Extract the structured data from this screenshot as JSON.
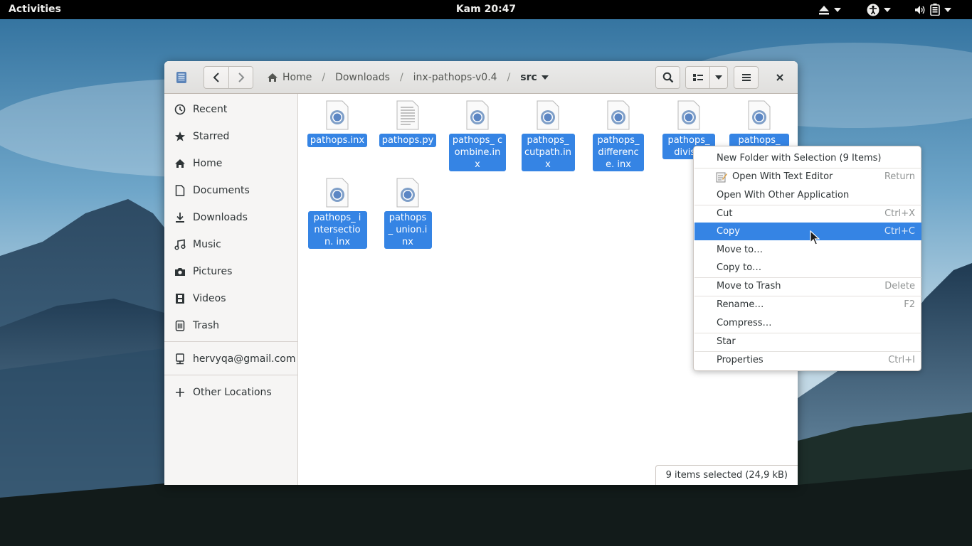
{
  "topbar": {
    "activities": "Activities",
    "clock": "Kam 20:47"
  },
  "window": {
    "breadcrumbs": [
      "Home",
      "Downloads",
      "inx-pathops-v0.4",
      "src"
    ]
  },
  "sidebar": {
    "items": [
      {
        "label": "Recent",
        "icon": "clock-icon"
      },
      {
        "label": "Starred",
        "icon": "star-icon"
      },
      {
        "label": "Home",
        "icon": "home-icon"
      },
      {
        "label": "Documents",
        "icon": "document-icon"
      },
      {
        "label": "Downloads",
        "icon": "download-icon"
      },
      {
        "label": "Music",
        "icon": "music-icon"
      },
      {
        "label": "Pictures",
        "icon": "camera-icon"
      },
      {
        "label": "Videos",
        "icon": "film-icon"
      },
      {
        "label": "Trash",
        "icon": "trash-icon"
      }
    ],
    "account": {
      "label": "hervyqa@gmail.com",
      "icon": "network-account-icon"
    },
    "other": {
      "label": "Other Locations",
      "icon": "plus-icon"
    }
  },
  "files": [
    {
      "name": "pathops.inx",
      "type": "web-document",
      "selected": true
    },
    {
      "name": "pathops.py",
      "type": "text-document",
      "selected": true
    },
    {
      "name": "pathops_ combine.inx",
      "type": "web-document",
      "selected": true
    },
    {
      "name": "pathops_ cutpath.inx",
      "type": "web-document",
      "selected": true
    },
    {
      "name": "pathops_ difference. inx",
      "type": "web-document",
      "selected": true
    },
    {
      "name": "pathops_ divisio",
      "type": "web-document",
      "selected": true
    },
    {
      "name": "pathops_",
      "type": "web-document",
      "selected": true
    },
    {
      "name": "pathops_ intersection. inx",
      "type": "web-document",
      "selected": true
    },
    {
      "name": "pathops_ union.inx",
      "type": "web-document",
      "selected": true
    }
  ],
  "status": "9 items selected  (24,9 kB)",
  "context_menu": {
    "items": [
      {
        "label": "New Folder with Selection (9 Items)",
        "accel": ""
      },
      {
        "label": "Open With Text Editor",
        "accel": "Return",
        "icon": "text-editor-icon"
      },
      {
        "label": "Open With Other Application",
        "accel": ""
      },
      {
        "label": "Cut",
        "accel": "Ctrl+X"
      },
      {
        "label": "Copy",
        "accel": "Ctrl+C",
        "active": true
      },
      {
        "label": "Move to…",
        "accel": ""
      },
      {
        "label": "Copy to…",
        "accel": ""
      },
      {
        "label": "Move to Trash",
        "accel": "Delete"
      },
      {
        "label": "Rename…",
        "accel": "F2"
      },
      {
        "label": "Compress…",
        "accel": ""
      },
      {
        "label": "Star",
        "accel": ""
      },
      {
        "label": "Properties",
        "accel": "Ctrl+I"
      }
    ]
  },
  "colors": {
    "selection": "#3584e4",
    "topbar": "#000000",
    "sidebar_bg": "#f6f5f4"
  }
}
